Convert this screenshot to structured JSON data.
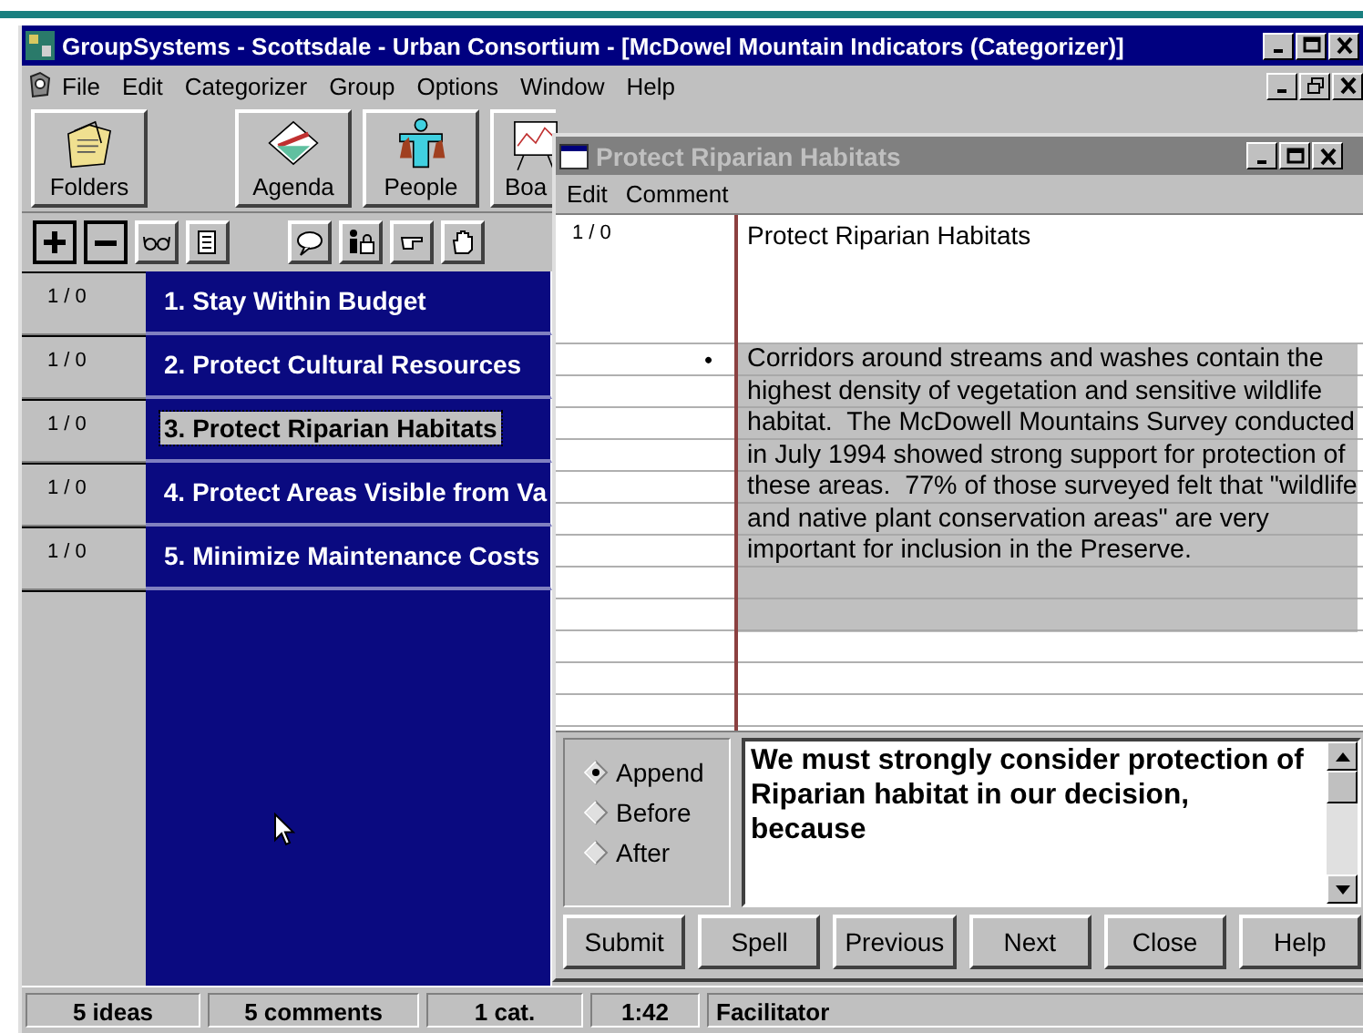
{
  "window": {
    "title": "GroupSystems - Scottsdale - Urban Consortium - [McDowel Mountain Indicators (Categorizer)]"
  },
  "menu_bar": [
    "File",
    "Edit",
    "Categorizer",
    "Group",
    "Options",
    "Window",
    "Help"
  ],
  "toolbar": [
    {
      "label": "Folders",
      "kind": "folder"
    },
    {
      "label": "Agenda",
      "kind": "agenda"
    },
    {
      "label": "People",
      "kind": "people"
    },
    {
      "label": "Boa",
      "kind": "board"
    }
  ],
  "categories": [
    {
      "count": "1 / 0",
      "label": "1. Stay Within Budget",
      "selected": false
    },
    {
      "count": "1 / 0",
      "label": "2. Protect Cultural Resources",
      "selected": false
    },
    {
      "count": "1 / 0",
      "label": "3. Protect Riparian Habitats",
      "selected": true
    },
    {
      "count": "1 / 0",
      "label": "4. Protect Areas Visible from Va",
      "selected": false
    },
    {
      "count": "1 / 0",
      "label": "5. Minimize Maintenance Costs",
      "selected": false
    }
  ],
  "comment_window": {
    "title": "Protect Riparian Habitats",
    "menu_bar": [
      "Edit",
      "Comment"
    ],
    "header": {
      "count": "1 / 0",
      "text": "Protect Riparian Habitats"
    },
    "comments": [
      {
        "marker": "•",
        "text": "Corridors around streams and washes contain the highest density of vegetation and sensitive wildlife habitat.  The McDowell Mountains Survey conducted in July 1994 showed strong support for protection of these areas.  77% of those surveyed felt that \"wildlife and native plant conservation areas\" are very important for inclusion in the Preserve.",
        "selected": true
      }
    ],
    "position_options": [
      {
        "label": "Append",
        "selected": true
      },
      {
        "label": "Before",
        "selected": false
      },
      {
        "label": "After",
        "selected": false
      }
    ],
    "comment_input": {
      "value": "We must strongly consider protection of Riparian habitat in our decision, because"
    },
    "buttons": [
      "Submit",
      "Spell",
      "Previous",
      "Next",
      "Close",
      "Help"
    ]
  },
  "status_bar": [
    "5 ideas",
    "5 comments",
    "1 cat.",
    "1:42",
    "Facilitator"
  ]
}
